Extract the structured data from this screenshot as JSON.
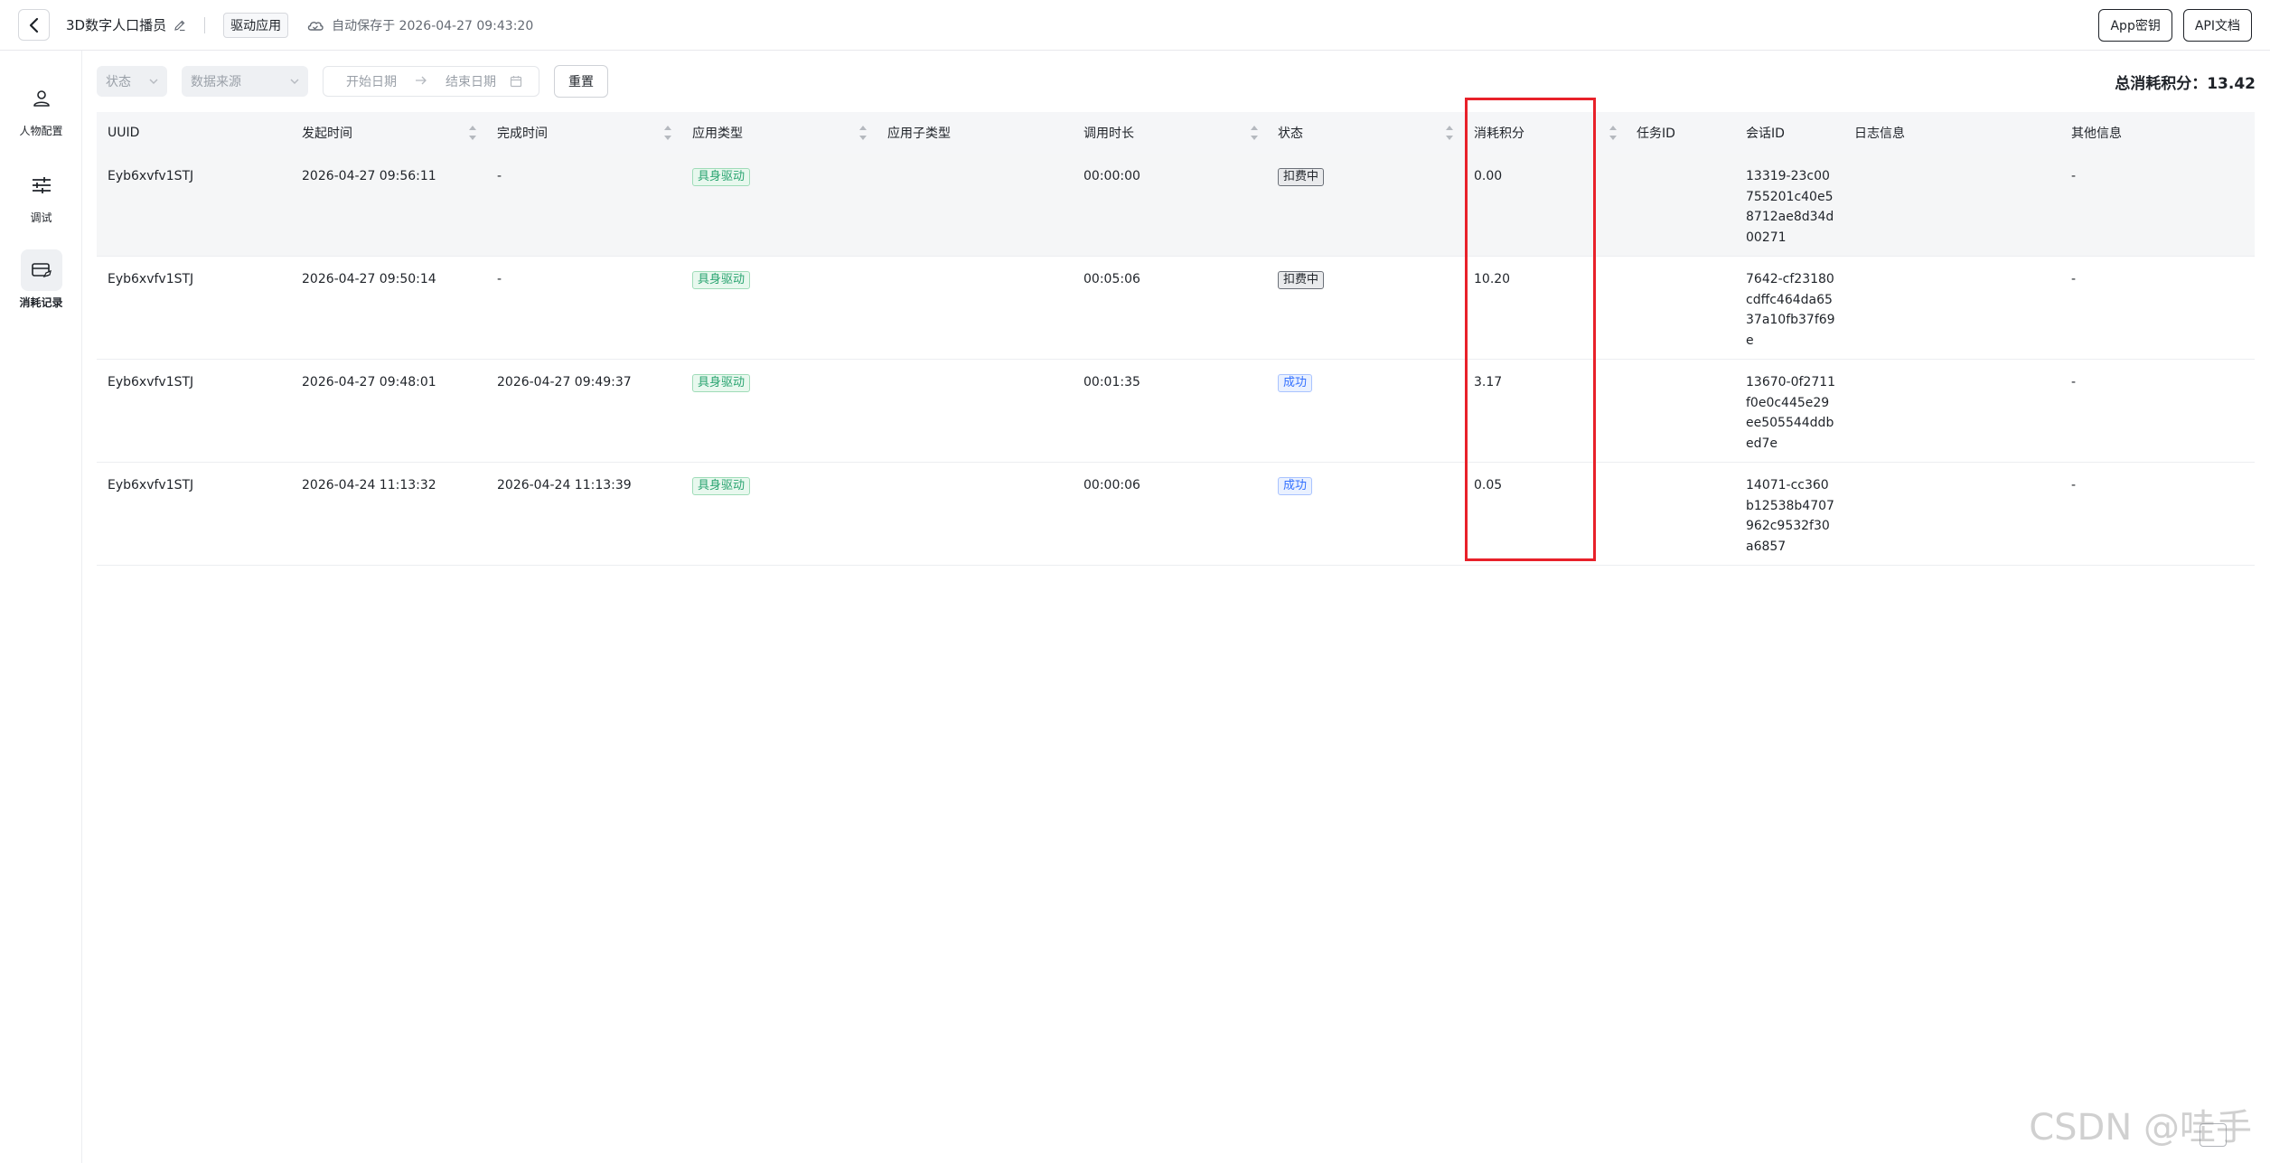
{
  "header": {
    "title": "3D数字人口播员",
    "app_tag": "驱动应用",
    "autosave": "自动保存于 2026-04-27 09:43:20",
    "btn_appkey": "App密钥",
    "btn_apidoc": "API文档"
  },
  "sidebar": {
    "items": [
      {
        "label": "人物配置",
        "icon": "person-icon"
      },
      {
        "label": "调试",
        "icon": "sliders-icon"
      },
      {
        "label": "消耗记录",
        "icon": "wallet-icon"
      }
    ]
  },
  "filters": {
    "status_placeholder": "状态",
    "source_placeholder": "数据来源",
    "start_date": "开始日期",
    "end_date": "结束日期",
    "reset": "重置"
  },
  "total": "总消耗积分：13.42",
  "table": {
    "columns": [
      "UUID",
      "发起时间",
      "完成时间",
      "应用类型",
      "应用子类型",
      "调用时长",
      "状态",
      "消耗积分",
      "任务ID",
      "会话ID",
      "日志信息",
      "其他信息"
    ],
    "rows": [
      {
        "uuid": "Eyb6xvfv1STJ",
        "start": "2026-04-27 09:56:11",
        "end": "-",
        "type": "具身驱动",
        "subtype": "",
        "duration": "00:00:00",
        "status": "扣费中",
        "points": "0.00",
        "task_id": "",
        "session_id": "13319-23c00755201c40e58712ae8d34d00271",
        "log": "",
        "other": "-"
      },
      {
        "uuid": "Eyb6xvfv1STJ",
        "start": "2026-04-27 09:50:14",
        "end": "-",
        "type": "具身驱动",
        "subtype": "",
        "duration": "00:05:06",
        "status": "扣费中",
        "points": "10.20",
        "task_id": "",
        "session_id": "7642-cf23180cdffc464da6537a10fb37f69e",
        "log": "",
        "other": "-"
      },
      {
        "uuid": "Eyb6xvfv1STJ",
        "start": "2026-04-27 09:48:01",
        "end": "2026-04-27 09:49:37",
        "type": "具身驱动",
        "subtype": "",
        "duration": "00:01:35",
        "status": "成功",
        "points": "3.17",
        "task_id": "",
        "session_id": "13670-0f2711f0e0c445e29ee505544ddbed7e",
        "log": "",
        "other": "-"
      },
      {
        "uuid": "Eyb6xvfv1STJ",
        "start": "2026-04-24 11:13:32",
        "end": "2026-04-24 11:13:39",
        "type": "具身驱动",
        "subtype": "",
        "duration": "00:00:06",
        "status": "成功",
        "points": "0.05",
        "task_id": "",
        "session_id": "14071-cc360b12538b4707962c9532f30a6857",
        "log": "",
        "other": "-"
      }
    ]
  },
  "watermark": "CSDN @哇手"
}
